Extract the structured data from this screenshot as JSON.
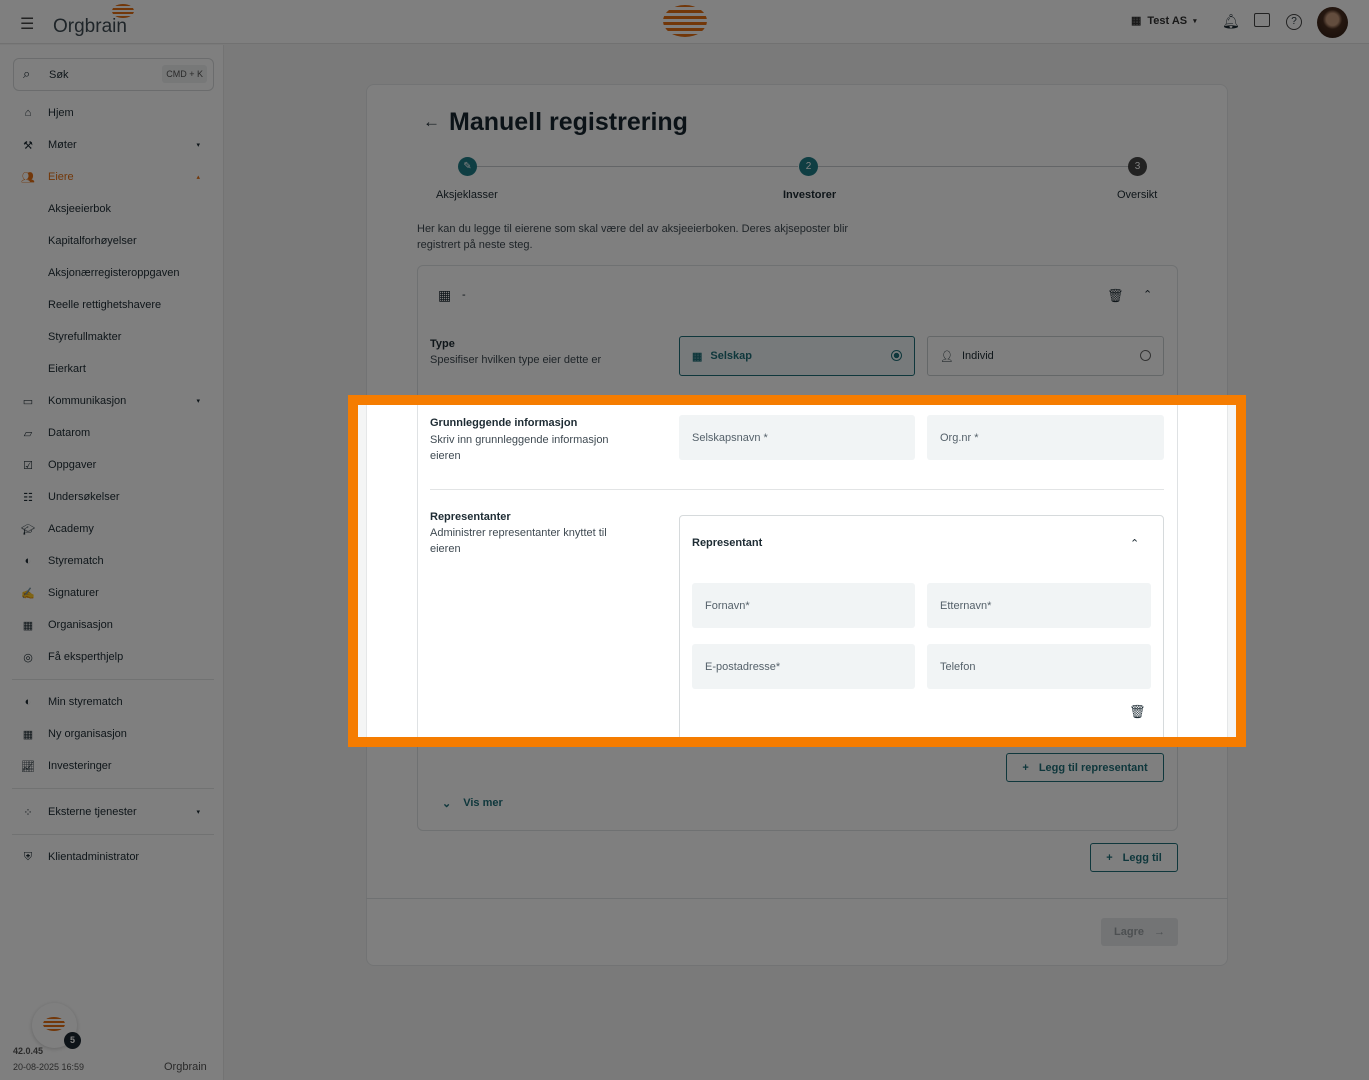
{
  "app": {
    "logo": "Orgbrain",
    "company": "Test AS",
    "version": "42.0.45",
    "timestamp": "20-08-2025 16:59",
    "badge_count": "5",
    "footer_logo": "Orgbrain"
  },
  "search": {
    "placeholder": "Søk",
    "shortcut": "CMD + K"
  },
  "sidebar": {
    "items": [
      {
        "label": "Hjem",
        "icon": "home-icon"
      },
      {
        "label": "Møter",
        "icon": "gavel-icon",
        "caret": "▾"
      },
      {
        "label": "Eiere",
        "icon": "people-icon",
        "caret": "▴",
        "active": true
      },
      {
        "label": "Aksjeeierbok",
        "sub": true
      },
      {
        "label": "Kapitalforhøyelser",
        "sub": true
      },
      {
        "label": "Aksjonærregisteroppgaven",
        "sub": true
      },
      {
        "label": "Reelle rettighetshavere",
        "sub": true
      },
      {
        "label": "Styrefullmakter",
        "sub": true
      },
      {
        "label": "Eierkart",
        "sub": true
      },
      {
        "label": "Kommunikasjon",
        "icon": "message-icon",
        "caret": "▾"
      },
      {
        "label": "Datarom",
        "icon": "folder-icon"
      },
      {
        "label": "Oppgaver",
        "icon": "task-icon"
      },
      {
        "label": "Undersøkelser",
        "icon": "survey-icon"
      },
      {
        "label": "Academy",
        "icon": "academy-icon"
      },
      {
        "label": "Styrematch",
        "icon": "match-icon"
      },
      {
        "label": "Signaturer",
        "icon": "signature-icon"
      },
      {
        "label": "Organisasjon",
        "icon": "building-icon"
      },
      {
        "label": "Få eksperthjelp",
        "icon": "expert-icon"
      },
      {
        "label": "Min styrematch",
        "icon": "match-icon"
      },
      {
        "label": "Ny organisasjon",
        "icon": "building-add-icon"
      },
      {
        "label": "Investeringer",
        "icon": "chart-icon"
      },
      {
        "label": "Eksterne tjenester",
        "icon": "apps-icon",
        "caret": "▾"
      },
      {
        "label": "Klientadministrator",
        "icon": "shield-icon"
      }
    ]
  },
  "page": {
    "title": "Manuell registrering",
    "steps": [
      {
        "num": "✎",
        "label": "Aksjeklasser"
      },
      {
        "num": "2",
        "label": "Investorer"
      },
      {
        "num": "3",
        "label": "Oversikt"
      }
    ],
    "description": "Her kan du legge til eierene som skal være del av aksjeeierboken. Deres akjseposter blir registrert på neste steg.",
    "owner": {
      "name": "-",
      "type_label": "Type",
      "type_desc": "Spesifiser hvilken type eier dette er",
      "options": [
        "Selskap",
        "Individ"
      ],
      "basic_label": "Grunnleggende informasjon",
      "basic_desc": "Skriv inn grunnleggende informasjon eieren",
      "company_name": "Selskapsnavn *",
      "org_nr": "Org.nr *",
      "reps_label": "Representanter",
      "reps_desc": "Administrer representanter knyttet til eieren",
      "rep_title": "Representant",
      "first_name": "Fornavn*",
      "last_name": "Etternavn*",
      "email": "E-postadresse*",
      "phone": "Telefon",
      "add_rep": "Legg til representant",
      "show_more": "Vis mer"
    },
    "add": "Legg til",
    "save": "Lagre"
  },
  "colors": {
    "accent": "#1f6f78",
    "brand": "#e56f12",
    "highlight": "#f57c00"
  }
}
